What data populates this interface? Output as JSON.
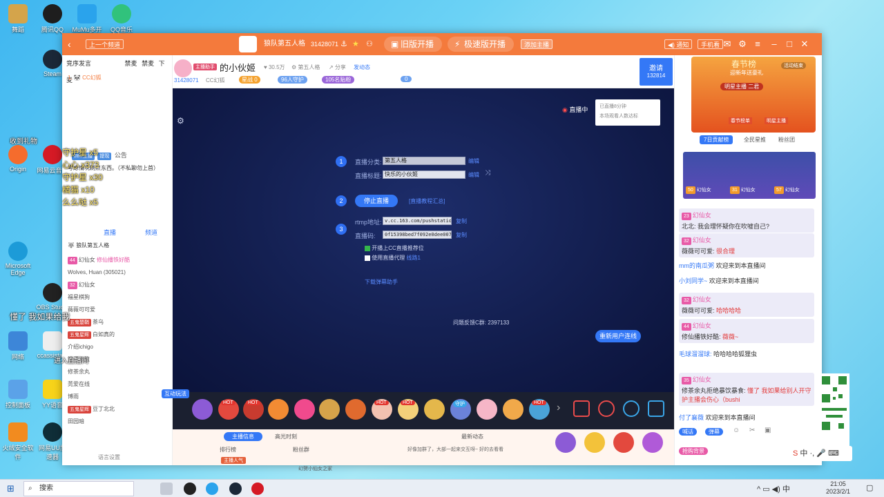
{
  "desktop": {
    "icons": [
      {
        "label": "舞蹈"
      },
      {
        "label": "腾讯QQ"
      },
      {
        "label": "MuMu多开"
      },
      {
        "label": "QQ音乐"
      },
      {
        "label": "Steam"
      },
      {
        "label": "Origin"
      },
      {
        "label": "网易云音乐"
      },
      {
        "label": "直播大师"
      },
      {
        "label": "控制面板"
      },
      {
        "label": "火绒安全软件"
      },
      {
        "label": "网易UU加速器"
      },
      {
        "label": "YY语音"
      },
      {
        "label": "OBS Studio"
      },
      {
        "label": "Microsoft Edge"
      },
      {
        "label": "ccassistant"
      },
      {
        "label": "网络"
      }
    ],
    "overlay_lines": [
      "收到礼物",
      "守护星 x5",
      "心心 x373",
      "守护星 x30",
      "橘猫 x10",
      "么么哒 x5",
      "修仙播铁好酷",
      "哒哒哈哈",
      "狐狸",
      "暂时超过五秒 已超饮食:",
      "懂了 我如果给我",
      "进入直播间"
    ]
  },
  "titlebar": {
    "back_label": "上一个频道",
    "channel_name": "狼队第五人格",
    "channel_id": "31428071",
    "old_stream_label": "旧版开播",
    "fast_stream_label": "极速版开播",
    "add_host_label": "添加主播",
    "notify_label": "通知",
    "phone_label": "手机看",
    "colors": {
      "bar": "#f47a3c",
      "accent": "#3478f6"
    }
  },
  "left": {
    "tabs": [
      "竞序发言",
      "禁麦",
      "禁麦",
      "下麦"
    ],
    "first_user": "CC幻狐",
    "section_labels": [
      "28w主播",
      "提现",
      "公告"
    ],
    "notice_text": "考虑情况刷点东西。（不私聊勿上首）",
    "sub_tabs": [
      "直播",
      "频道"
    ],
    "room_title": "狼队第五人格",
    "rows": [
      {
        "badge": "44",
        "name": "幻仙女",
        "text": "修仙播铁好酷"
      },
      {
        "badge": "",
        "name": "Wolves, Huan",
        "text": "(305021)"
      },
      {
        "badge": "32",
        "name": "幻仙女",
        "text": ""
      },
      {
        "badge": "",
        "name": "福星棋狗",
        "text": ""
      },
      {
        "badge": "",
        "name": "薇薇可可爱",
        "text": ""
      },
      {
        "badge": "",
        "name": "五鬼楚鞘",
        "text": "茶乌"
      },
      {
        "badge": "",
        "name": "五鬼星辉",
        "text": "白如真的"
      },
      {
        "badge": "",
        "name": "介绍ichigo",
        "text": ""
      },
      {
        "badge": "",
        "name": "篮子非篮",
        "text": ""
      },
      {
        "badge": "",
        "name": "修茶余丸",
        "text": ""
      },
      {
        "badge": "",
        "name": "莞爱在线",
        "text": ""
      },
      {
        "badge": "",
        "name": "博雨",
        "text": ""
      },
      {
        "badge": "",
        "name": "五鬼星辉",
        "text": "豆丁北北"
      },
      {
        "badge": "",
        "name": "田园暗",
        "text": ""
      }
    ],
    "footer": "语言设置"
  },
  "streamer": {
    "name": "的小伙姬",
    "host_tag": "主播助手",
    "room_id": "31428071",
    "fans": "30.5万",
    "game": "第五人格",
    "share": "分享",
    "dynamic": "发动态",
    "level_label": "星战",
    "level_value": "0",
    "guard_count": "96人守护",
    "gift_count": "105名贴粉",
    "likes": "0",
    "invite_label": "邀请",
    "invite_count": "132814",
    "cc_label": "CC幻狐"
  },
  "video": {
    "live_label": "直播中",
    "live_info": [
      "已直播8分钟",
      "本场观看人数达标"
    ],
    "step1": {
      "n": "1",
      "category_label": "直播分类:",
      "category_value": "第五人格",
      "edit": "编辑",
      "title_label": "直播标题:",
      "title_value": "快乐的小伙姬",
      "edit2": "编辑"
    },
    "step2": {
      "n": "2",
      "stop_button": "停止直播",
      "tutorial_link": "[直播教程汇总]"
    },
    "step3": {
      "n": "3",
      "rtmp_label": "rtmp地址:",
      "rtmp_value": "v.cc.163.com/pushstation",
      "copy1": "复制",
      "key_label": "直播码:",
      "key_value": "0f15398bed7f092e0dee0072",
      "copy2": "复制"
    },
    "checks": [
      {
        "label": "开播上CC直播推荐位",
        "checked": true
      },
      {
        "label": "使用直播代理",
        "checked": false,
        "extra": "线路1"
      }
    ],
    "download_link": "下载弹幕助手",
    "feedback_label": "问题反馈C群:",
    "feedback_value": "2397133",
    "reconnect_button": "重新用户连线"
  },
  "gifts": {
    "live_gift_tag": "互动玩法",
    "hot_labels": [
      "HOT",
      "HOT",
      "HOT",
      "HOT",
      "守护",
      "HOT"
    ]
  },
  "bottom": {
    "tabs": [
      "主播信息",
      "高光时刻",
      "最新动态"
    ],
    "col_labels": [
      "排行榜",
      "粉丝群"
    ],
    "fan_group": "幻贺小仙女之家",
    "join_label": "修改粉丝群",
    "rank_tag": "主播人气",
    "posts": [
      {
        "user": "",
        "text": "好像加群了，大部一起来交互呀~ 好的去看看"
      },
      {
        "user": "豆丁北北",
        "text": "在本房间说: 我会理怀疑你在吹嘘自己?"
      }
    ],
    "bottom_icons": [
      "射箭",
      "心愿",
      "新春礼花",
      "小仙女灵",
      "星际穿越",
      "月亮宝藏",
      "钻石粉丝",
      "投票器"
    ]
  },
  "right": {
    "event_title": "春节榜",
    "event_sub": "迎新年送豪礼",
    "event_live": "活动结束",
    "event_star": "明星主播 二君",
    "event_tags": [
      "春节榜单",
      "明星主播"
    ],
    "tabs": [
      "7日贡献榜",
      "全民星推",
      "粉丝团"
    ],
    "ranks": [
      {
        "level": "50",
        "name": "幻仙女",
        "rank_name": "可狂来吃小华"
      },
      {
        "level": "31",
        "name": "幻仙女",
        "rank_name": "龙须酥雪花"
      },
      {
        "level": "57",
        "name": "幻仙女",
        "rank_name": "鹿彩教我玩"
      }
    ],
    "chat": [
      {
        "type": "msg",
        "badge": "23",
        "name": "幻仙女",
        "line1": "北北:",
        "line2": "我会理怀疑你在吹嘘自己?"
      },
      {
        "type": "msg",
        "badge": "32",
        "name": "幻仙女",
        "line1": "薇薇可可爱:",
        "line2": "很合理"
      },
      {
        "type": "plain",
        "user": "mm的南瓜粥",
        "text": "欢迎来到本直播间"
      },
      {
        "type": "plain",
        "user": "小刘同学~",
        "text": "欢迎来到本直播间"
      },
      {
        "type": "msg",
        "badge": "32",
        "name": "幻仙女",
        "line1": "薇薇可可爱:",
        "line2": "哈哈哈哈"
      },
      {
        "type": "msg",
        "badge": "44",
        "name": "幻仙女",
        "line1": "修仙播铁好酷:",
        "line2": "薇薇~"
      },
      {
        "type": "plain",
        "user": "毛球溜溜球:",
        "text": "哈哈哈哈狐狸虫"
      },
      {
        "type": "msg",
        "badge": "35",
        "name": "幻仙女",
        "line1": "修茶余丸拒绝暴饮暴食:",
        "line2": "懂了 我如果给别人开守护主播会伤心（bushi"
      },
      {
        "type": "plain",
        "user": "付了襄薇",
        "text": "欢迎来到本直播间"
      }
    ],
    "input_tags": [
      "喊话",
      "弹幕"
    ],
    "send_icons": [
      "emoji",
      "scissors",
      "image",
      "star",
      "more"
    ],
    "ime_label": "中",
    "bottom_button": "抢购背景"
  },
  "taskbar": {
    "search_placeholder": "搜索",
    "time": "21:05",
    "date": "2023/2/1",
    "ime": "中"
  }
}
